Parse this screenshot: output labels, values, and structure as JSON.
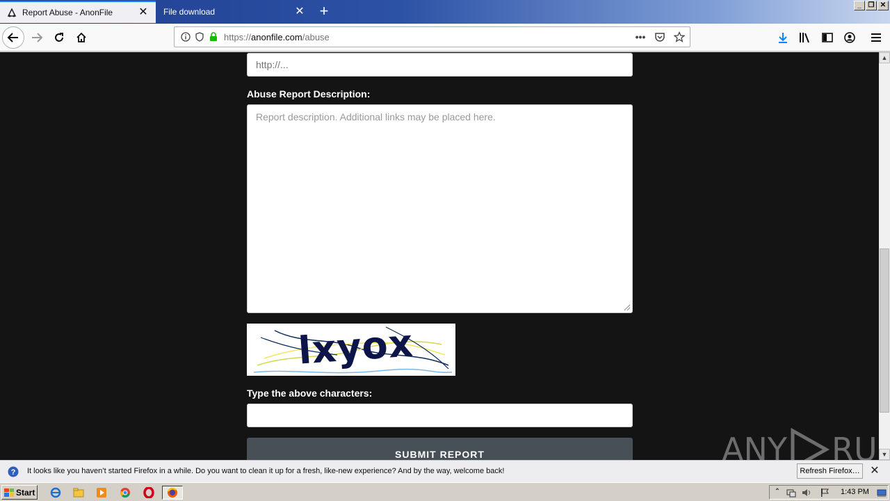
{
  "browser": {
    "tabs": [
      {
        "title": "Report Abuse - AnonFile",
        "active": true
      },
      {
        "title": "File download",
        "active": false
      }
    ],
    "url": {
      "scheme": "https://",
      "host": "anonfile.com",
      "path": "/abuse"
    }
  },
  "page": {
    "url_field_placeholder": "http://...",
    "description_label": "Abuse Report Description:",
    "description_placeholder": "Report description. Additional links may be placed here.",
    "captcha_text": "lxyox",
    "captcha_label": "Type the above characters:",
    "captcha_value": "",
    "submit_label": "SUBMIT REPORT"
  },
  "watermark": {
    "left": "ANY",
    "right": "RUN"
  },
  "notification": {
    "message": "It looks like you haven’t started Firefox in a while. Do you want to clean it up for a fresh, like-new experience? And by the way, welcome back!",
    "button_label": "Refresh Firefox…"
  },
  "taskbar": {
    "start_label": "Start",
    "clock": "1:43 PM"
  },
  "colors": {
    "page_background": "#141414",
    "submit_button": "#475057",
    "firefox_accent": "#0a84ff"
  }
}
